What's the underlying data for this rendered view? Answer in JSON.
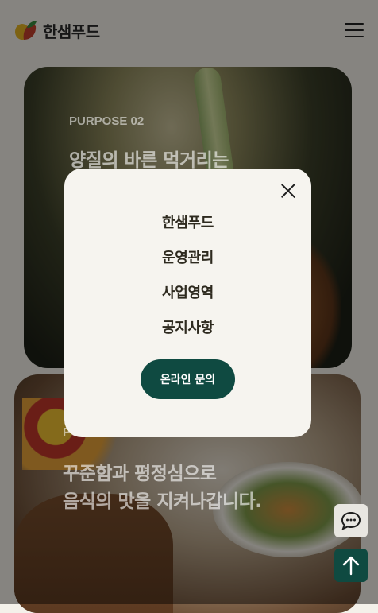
{
  "header": {
    "logo_text": "한샘푸드",
    "menu_icon": "hamburger-menu-icon"
  },
  "cards": [
    {
      "label": "PURPOSE 02",
      "title_lines": [
        "양질의 바른 먹거리는"
      ]
    },
    {
      "label": "PU",
      "title_lines": [
        "꾸준함과 평정심으로",
        "음식의 맛을 지켜나갑니다."
      ]
    }
  ],
  "modal": {
    "close_icon": "close-icon",
    "nav_items": [
      "한샘푸드",
      "운영관리",
      "사업영역",
      "공지사항"
    ],
    "cta_label": "온라인 문의"
  },
  "floating": {
    "chat_icon": "chat-bubble-icon",
    "top_icon": "arrow-up-icon"
  },
  "colors": {
    "brand_green": "#0f4a41",
    "background": "#f4f1ea",
    "modal_bg": "#f6f4ef"
  }
}
